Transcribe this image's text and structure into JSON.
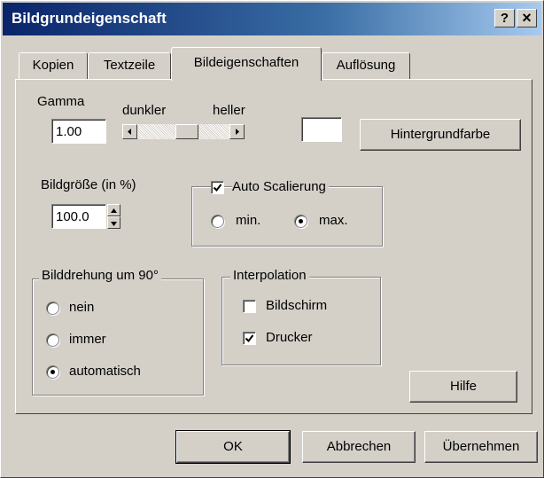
{
  "window": {
    "title": "Bildgrundeigenschaft",
    "help_button": "?",
    "close_button": "×"
  },
  "tabs": [
    {
      "label": "Kopien",
      "active": false
    },
    {
      "label": "Textzeile",
      "active": false
    },
    {
      "label": "Bildeigenschaften",
      "active": true
    },
    {
      "label": "Auflösung",
      "active": false
    }
  ],
  "gamma": {
    "label": "Gamma",
    "value": "1.00",
    "darker_label": "dunkler",
    "lighter_label": "heller",
    "slider_level": 0.55
  },
  "background_button": "Hintergrundfarbe",
  "background_color": "#ffffff",
  "image_size": {
    "label": "Bildgröße (in %)",
    "value": "100.0"
  },
  "auto_scale": {
    "label": "Auto Scalierung",
    "checked": true,
    "options": [
      {
        "label": "min.",
        "selected": false
      },
      {
        "label": "max.",
        "selected": true
      }
    ]
  },
  "rotation": {
    "label": "Bilddrehung um 90°",
    "options": [
      {
        "label": "nein",
        "selected": false
      },
      {
        "label": "immer",
        "selected": false
      },
      {
        "label": "automatisch",
        "selected": true
      }
    ]
  },
  "interpolation": {
    "label": "Interpolation",
    "options": [
      {
        "label": "Bildschirm",
        "checked": false
      },
      {
        "label": "Drucker",
        "checked": true
      }
    ]
  },
  "buttons": {
    "help": "Hilfe",
    "ok": "OK",
    "cancel": "Abbrechen",
    "apply": "Übernehmen"
  }
}
